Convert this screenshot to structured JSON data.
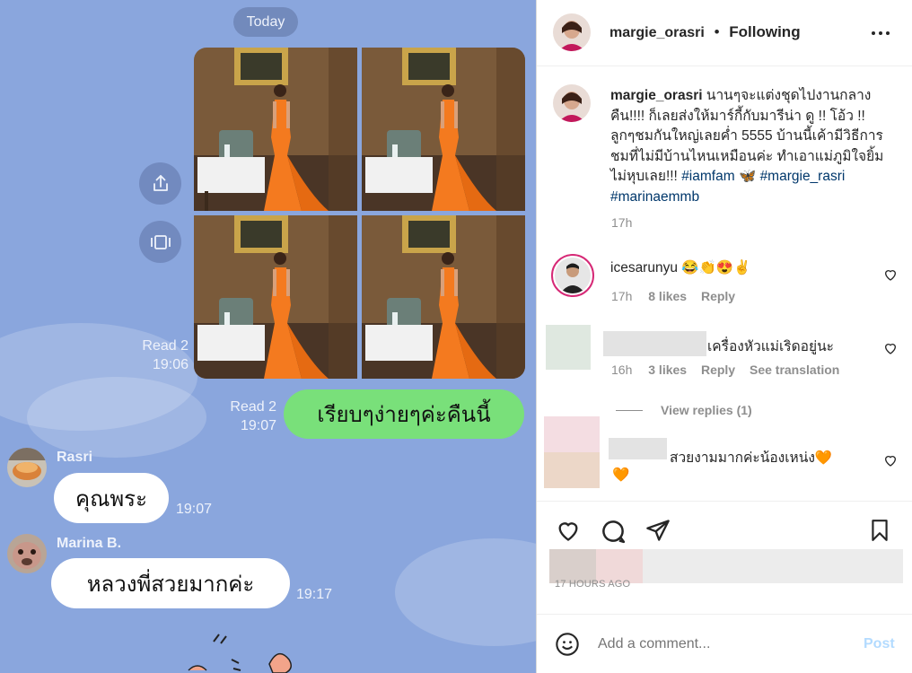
{
  "chat": {
    "date_pill": "Today",
    "photo_read": "Read 2",
    "photo_time": "19:06",
    "msg1": {
      "read": "Read 2",
      "time": "19:07",
      "text": "เรียบๆง่ายๆค่ะคืนนี้"
    },
    "msg2": {
      "sender": "Rasri",
      "text": "คุณพระ",
      "time": "19:07"
    },
    "msg3": {
      "sender": "Marina B.",
      "text": "หลวงพี่สวยมากค่ะ",
      "time": "19:17"
    },
    "colors": {
      "background": "#8aa6dd",
      "sent_bubble": "#79e07a",
      "dress": "#f47a1f"
    }
  },
  "instagram": {
    "username": "margie_orasri",
    "separator": "•",
    "follow_status": "Following",
    "more_icon": "more-horizontal-icon",
    "caption": {
      "username": "margie_orasri",
      "text": "นานๆจะแต่งชุดไปงานกลางคืน!!!! ก็เลยส่งให้มาร์กี้กับมารีน่า ดู !! โอ้ว !! ลูกๆชมกันใหญ่เลยค่ำ 5555 บ้านนี้เค้ามีวิธีการชมที่ไม่มีบ้านไหนเหมือนค่ะ ทำเอาแม่ภูมิใจยิ้มไม่หุบเลย!!!",
      "tag1": "#iamfam",
      "tag2": "#margie_rasri",
      "tag3": "#marinaemmb",
      "time": "17h"
    },
    "comments": [
      {
        "user": "icesarunyu",
        "text": "😂👏😍✌",
        "time": "17h",
        "likes": "8 likes",
        "reply": "Reply"
      },
      {
        "user": "",
        "text": "เครื่องหัวแม่เริดอยู่นะ",
        "time": "16h",
        "likes": "3 likes",
        "reply": "Reply",
        "translate": "See translation"
      },
      {
        "user": "",
        "text": "สวยงามมากค่ะน้องเหน่ง🧡",
        "text2": "🧡"
      }
    ],
    "view_replies": "View replies (1)",
    "posted": "17 HOURS AGO",
    "add_comment_placeholder": "Add a comment...",
    "post_button": "Post",
    "colors": {
      "link": "#00376b",
      "post_disabled": "#b3dbff",
      "muted": "#8e8e8e"
    }
  }
}
